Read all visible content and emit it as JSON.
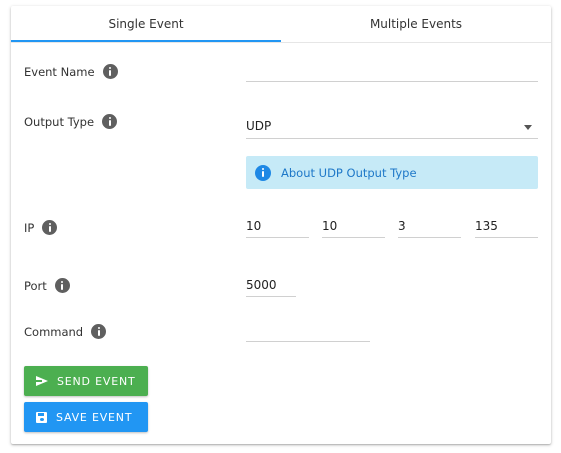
{
  "tabs": [
    {
      "label": "Single Event",
      "active": true
    },
    {
      "label": "Multiple Events",
      "active": false
    }
  ],
  "form": {
    "event_name": {
      "label": "Event Name",
      "value": ""
    },
    "output_type": {
      "label": "Output Type",
      "value": "UDP"
    },
    "alert": {
      "text": "About UDP Output Type"
    },
    "ip": {
      "label": "IP",
      "octets": [
        "10",
        "10",
        "3",
        "135"
      ]
    },
    "port": {
      "label": "Port",
      "value": "5000"
    },
    "command": {
      "label": "Command",
      "value": ""
    }
  },
  "buttons": {
    "send": {
      "label": "SEND EVENT",
      "color": "#4caf50",
      "icon": "send-icon"
    },
    "save": {
      "label": "SAVE EVENT",
      "color": "#2196f3",
      "icon": "save-icon"
    }
  },
  "colors": {
    "accent": "#2196f3",
    "alert_bg": "#c6eaf7",
    "alert_text": "#1e78c8"
  },
  "icons": {
    "info": "info-icon",
    "dropdown": "chevron-down-icon"
  }
}
